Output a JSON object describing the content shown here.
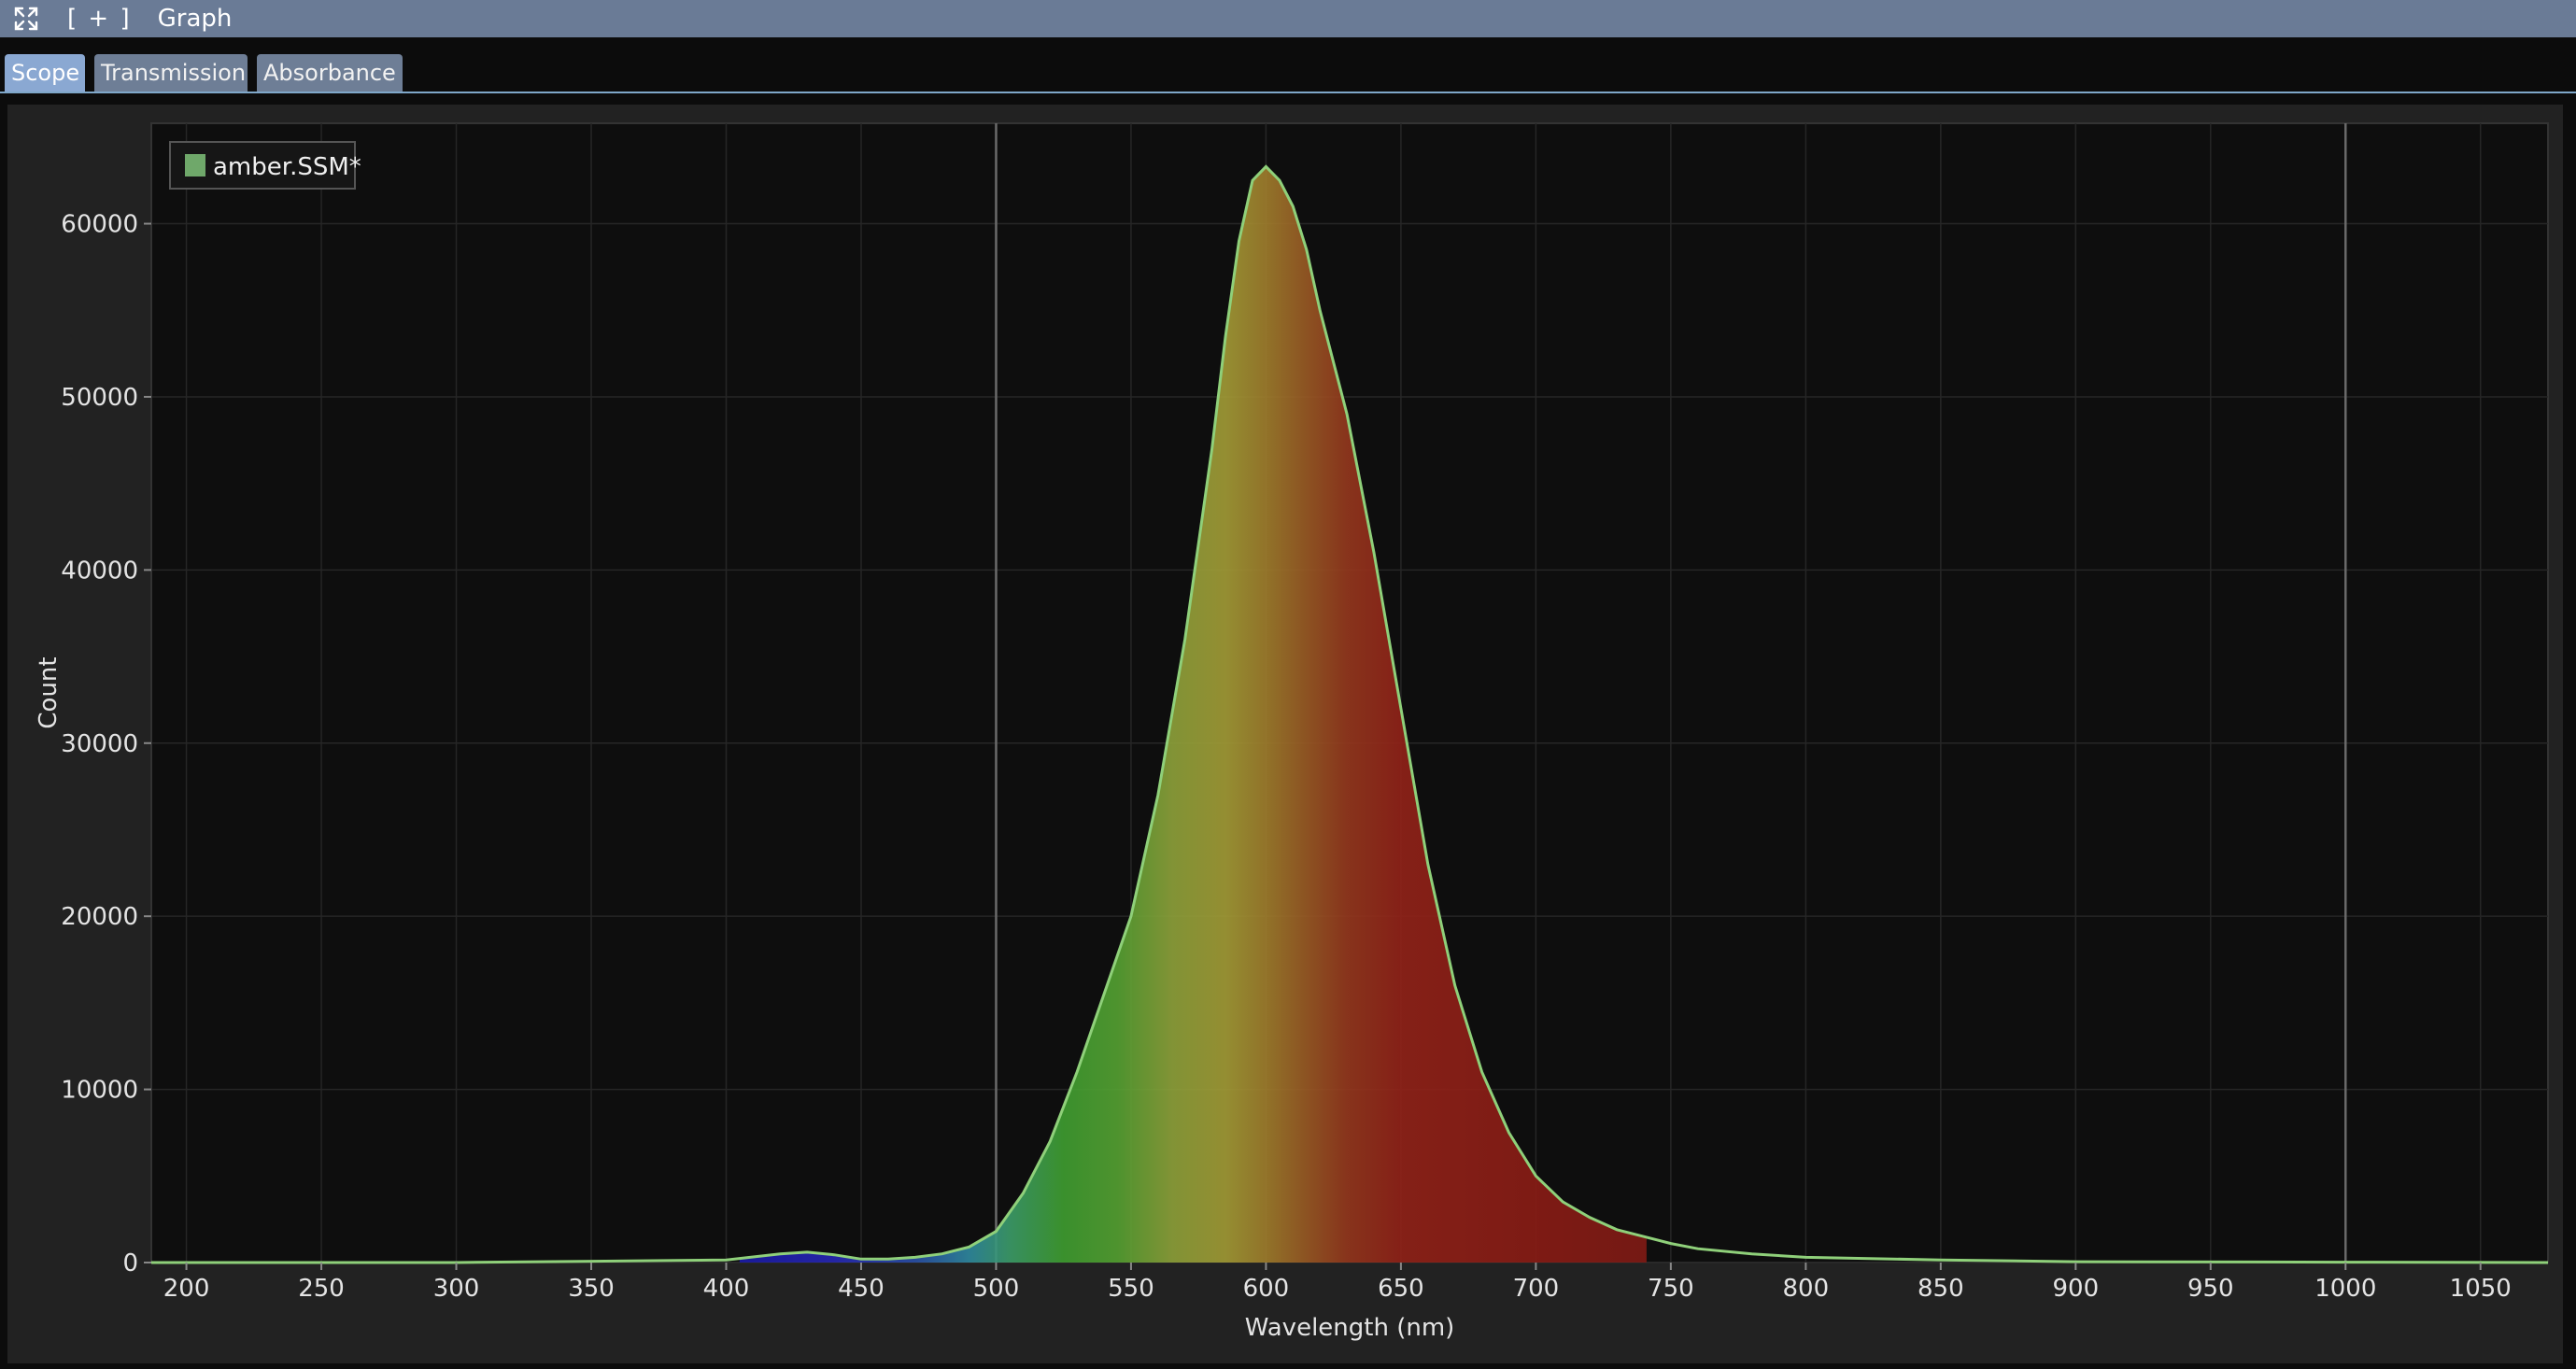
{
  "window": {
    "title": "Graph",
    "add_label": "[ + ]",
    "expand_icon": "expand-icon"
  },
  "tabs": [
    {
      "label": "Scope",
      "active": true
    },
    {
      "label": "Transmission",
      "active": false
    },
    {
      "label": "Absorbance",
      "active": false
    }
  ],
  "colors": {
    "titlebar": "#6a7b96",
    "tab_active": "#8aa8d2",
    "tab_inactive": "#6e7e96",
    "series_line": "#8fd07a",
    "legend_swatch": "#6fa86a"
  },
  "chart_data": {
    "type": "area",
    "title": "",
    "xlabel": "Wavelength (nm)",
    "ylabel": "Count",
    "xlim": [
      187,
      1075
    ],
    "ylim": [
      0,
      65800
    ],
    "xticks": [
      200,
      250,
      300,
      350,
      400,
      450,
      500,
      550,
      600,
      650,
      700,
      750,
      800,
      850,
      900,
      950,
      1000,
      1050
    ],
    "yticks": [
      0,
      10000,
      20000,
      30000,
      40000,
      50000,
      60000
    ],
    "grid": true,
    "legend_position": "top-left",
    "vertical_markers": [
      500,
      1000
    ],
    "fill_range": [
      405,
      741
    ],
    "series": [
      {
        "name": "amber.SSM*",
        "x": [
          187,
          300,
          400,
          420,
          430,
          440,
          450,
          460,
          470,
          480,
          490,
          500,
          510,
          520,
          530,
          540,
          550,
          560,
          570,
          580,
          585,
          590,
          595,
          600,
          605,
          610,
          615,
          620,
          630,
          640,
          650,
          660,
          670,
          680,
          690,
          700,
          710,
          720,
          730,
          740,
          750,
          760,
          780,
          800,
          850,
          900,
          1000,
          1075
        ],
        "y": [
          0,
          0,
          150,
          500,
          600,
          450,
          200,
          200,
          300,
          500,
          900,
          1800,
          4000,
          7000,
          11000,
          15500,
          20000,
          27000,
          36000,
          47000,
          53500,
          59000,
          62500,
          63300,
          62500,
          61000,
          58500,
          55000,
          49000,
          41000,
          32000,
          23000,
          16000,
          11000,
          7500,
          5000,
          3500,
          2600,
          1900,
          1500,
          1100,
          800,
          500,
          300,
          150,
          50,
          20,
          0
        ]
      }
    ]
  }
}
